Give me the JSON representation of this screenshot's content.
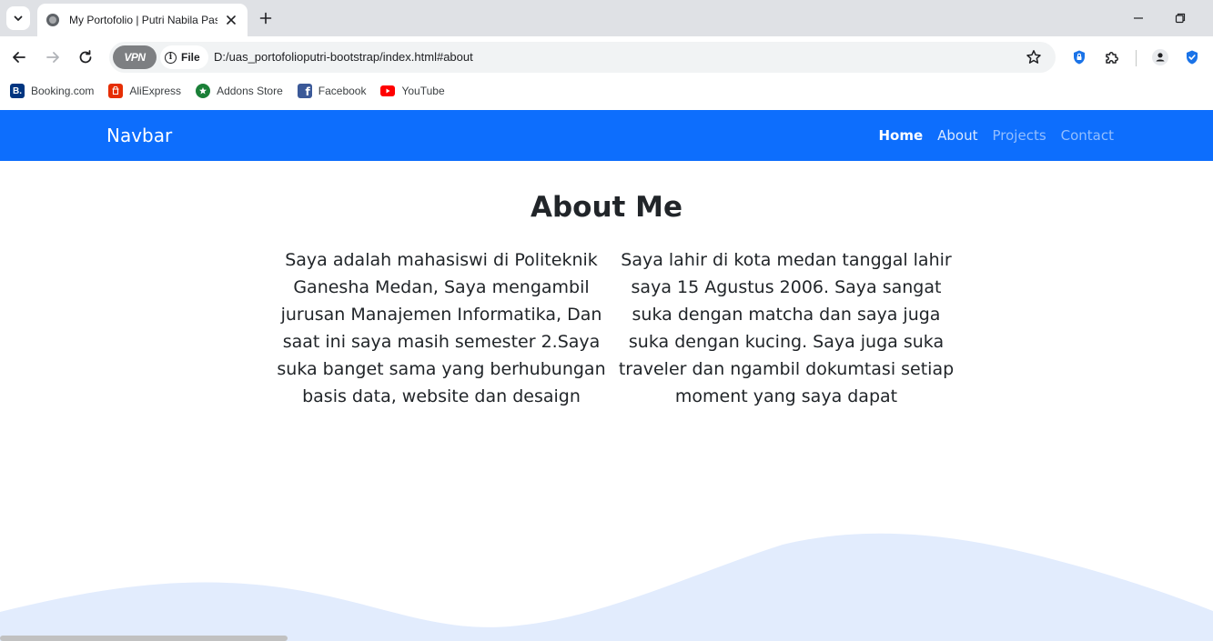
{
  "browser": {
    "tab_title": "My Portofolio | Putri Nabila Pas",
    "url_scheme_label": "File",
    "vpn_label": "VPN",
    "url": "D:/uas_portofolioputri-bootstrap/index.html#about",
    "bookmarks": [
      {
        "label": "Booking.com",
        "icon": "booking-icon",
        "color": "#003580"
      },
      {
        "label": "AliExpress",
        "icon": "aliexpress-icon",
        "color": "#e62e04"
      },
      {
        "label": "Addons Store",
        "icon": "addons-store-icon",
        "color": "#1a7f37"
      },
      {
        "label": "Facebook",
        "icon": "facebook-icon",
        "color": "#1877f2"
      },
      {
        "label": "YouTube",
        "icon": "youtube-icon",
        "color": "#ff0000"
      }
    ]
  },
  "site": {
    "brand": "Navbar",
    "nav": {
      "home": "Home",
      "about": "About",
      "projects": "Projects",
      "contact": "Contact"
    },
    "accent_color": "#0d6efd",
    "about": {
      "title": "About Me",
      "left_paragraph": "Saya adalah mahasiswi di Politeknik Ganesha Medan, Saya mengambil jurusan Manajemen Informatika, Dan saat ini saya masih semester 2.Saya suka banget sama yang berhubungan basis data, website dan desaign",
      "right_paragraph": "Saya lahir di kota medan tanggal lahir saya 15 Agustus 2006. Saya sangat suka dengan matcha dan saya juga suka dengan kucing. Saya juga suka traveler dan ngambil dokumtasi setiap moment yang saya dapat"
    },
    "wave_color": "#e2ecfd"
  }
}
